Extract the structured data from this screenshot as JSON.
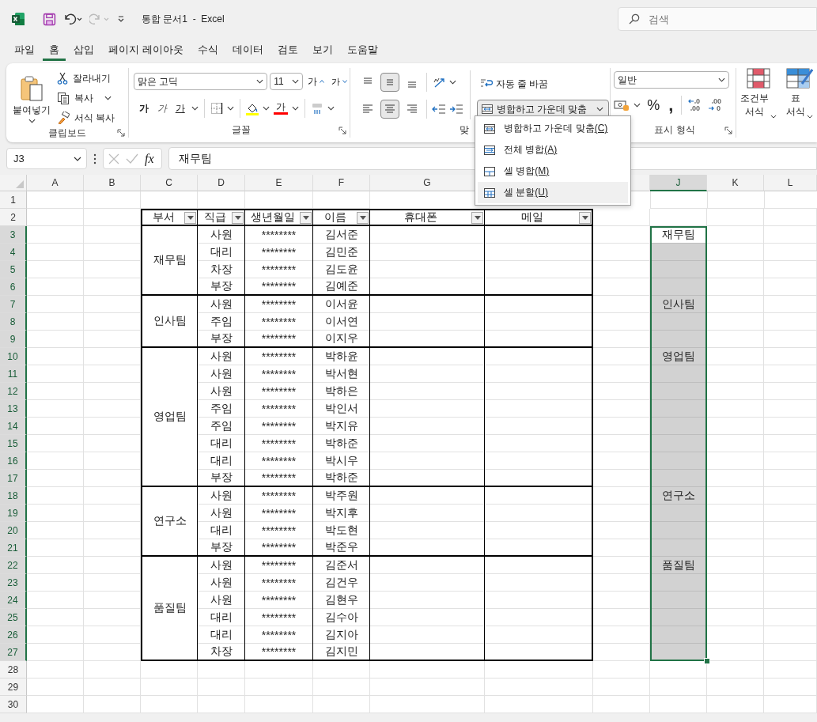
{
  "titlebar": {
    "quick_access": [
      {
        "kind": "save",
        "disabled": false
      },
      {
        "kind": "undo",
        "disabled": false
      },
      {
        "kind": "redo",
        "disabled": true
      },
      {
        "kind": "customize",
        "disabled": false
      }
    ],
    "title": "통합 문서1  -  Excel",
    "search": {
      "placeholder": "검색"
    }
  },
  "menu_tabs": [
    {
      "label": "파일",
      "selected": false
    },
    {
      "label": "홈",
      "selected": true
    },
    {
      "label": "삽입",
      "selected": false
    },
    {
      "label": "페이지 레이아웃",
      "selected": false
    },
    {
      "label": "수식",
      "selected": false
    },
    {
      "label": "데이터",
      "selected": false
    },
    {
      "label": "검토",
      "selected": false
    },
    {
      "label": "보기",
      "selected": false
    },
    {
      "label": "도움말",
      "selected": false
    }
  ],
  "ribbon": {
    "clipboard": {
      "label": "클립보드",
      "paste": "붙여넣기",
      "cut": "잘라내기",
      "copy": "복사",
      "format_painter": "서식 복사"
    },
    "font": {
      "label": "글꼴",
      "font_name": "맑은 고딕",
      "font_size": "11",
      "grow": "가",
      "shrink": "가",
      "bold": "가",
      "italic": "가",
      "underline": "가",
      "font_color": "가"
    },
    "alignment": {
      "label": "맞",
      "vertical_align": [
        {
          "kind": "top",
          "selected": false
        },
        {
          "kind": "middle",
          "selected": true
        },
        {
          "kind": "bottom",
          "selected": false
        }
      ],
      "horizontal_align": [
        {
          "kind": "left",
          "selected": false
        },
        {
          "kind": "center",
          "selected": true
        },
        {
          "kind": "right",
          "selected": false
        }
      ],
      "wrap_text": "자동 줄 바꿈",
      "merge": "병합하고 가운데 맞춤"
    },
    "number": {
      "label": "표시 형식",
      "format": "일반",
      "percent": "%",
      "comma": ","
    },
    "styles": {
      "conditional": "조건부 서식",
      "table": "표 서식"
    }
  },
  "merge_menu": {
    "open": true,
    "items": [
      {
        "label": "병합하고 가운데 맞춤",
        "shortcut": "(C)",
        "kind": "merge-center",
        "selected": false
      },
      {
        "label": "전체 병합",
        "shortcut": "(A)",
        "kind": "merge-across",
        "selected": false
      },
      {
        "label": "셀 병합",
        "shortcut": "(M)",
        "kind": "merge-cells",
        "selected": false
      },
      {
        "label": "셀 분할",
        "shortcut": "(U)",
        "kind": "unmerge",
        "selected": true
      }
    ]
  },
  "formula_bar": {
    "name_box": "J3",
    "fx": "fx",
    "value": "재무팀"
  },
  "sheet": {
    "columns": [
      {
        "header": "A",
        "selected": false
      },
      {
        "header": "B",
        "selected": false
      },
      {
        "header": "C",
        "selected": false
      },
      {
        "header": "D",
        "selected": false
      },
      {
        "header": "E",
        "selected": false
      },
      {
        "header": "F",
        "selected": false
      },
      {
        "header": "G",
        "selected": false
      },
      {
        "header": "J",
        "selected": true
      },
      {
        "header": "K",
        "selected": false
      },
      {
        "header": "L",
        "selected": false
      }
    ],
    "rows": [
      {
        "header": "1",
        "selected": false
      },
      {
        "header": "2",
        "selected": false
      },
      {
        "header": "3",
        "selected": true
      },
      {
        "header": "4",
        "selected": true
      },
      {
        "header": "5",
        "selected": true
      },
      {
        "header": "6",
        "selected": true
      },
      {
        "header": "7",
        "selected": true
      },
      {
        "header": "8",
        "selected": true
      },
      {
        "header": "9",
        "selected": true
      },
      {
        "header": "10",
        "selected": true
      },
      {
        "header": "11",
        "selected": true
      },
      {
        "header": "12",
        "selected": true
      },
      {
        "header": "13",
        "selected": true
      },
      {
        "header": "14",
        "selected": true
      },
      {
        "header": "15",
        "selected": true
      },
      {
        "header": "16",
        "selected": true
      },
      {
        "header": "17",
        "selected": true
      },
      {
        "header": "18",
        "selected": true
      },
      {
        "header": "19",
        "selected": true
      },
      {
        "header": "20",
        "selected": true
      },
      {
        "header": "21",
        "selected": true
      },
      {
        "header": "22",
        "selected": true
      },
      {
        "header": "23",
        "selected": true
      },
      {
        "header": "24",
        "selected": true
      },
      {
        "header": "25",
        "selected": true
      },
      {
        "header": "26",
        "selected": true
      },
      {
        "header": "27",
        "selected": true
      },
      {
        "header": "28",
        "selected": false
      },
      {
        "header": "29",
        "selected": false
      },
      {
        "header": "30",
        "selected": false
      }
    ],
    "table": {
      "headers": [
        "부서",
        "직급",
        "생년월일",
        "이름",
        "휴대폰",
        "메일"
      ],
      "groups": [
        {
          "department": "재무팀",
          "members": [
            {
              "rank": "사원",
              "birth": "********",
              "name": "김서준"
            },
            {
              "rank": "대리",
              "birth": "********",
              "name": "김민준"
            },
            {
              "rank": "차장",
              "birth": "********",
              "name": "김도윤"
            },
            {
              "rank": "부장",
              "birth": "********",
              "name": "김예준"
            }
          ]
        },
        {
          "department": "인사팀",
          "members": [
            {
              "rank": "사원",
              "birth": "********",
              "name": "이서윤"
            },
            {
              "rank": "주임",
              "birth": "********",
              "name": "이서연"
            },
            {
              "rank": "부장",
              "birth": "********",
              "name": "이지우"
            }
          ]
        },
        {
          "department": "영업팀",
          "members": [
            {
              "rank": "사원",
              "birth": "********",
              "name": "박하윤"
            },
            {
              "rank": "사원",
              "birth": "********",
              "name": "박서현"
            },
            {
              "rank": "사원",
              "birth": "********",
              "name": "박하은"
            },
            {
              "rank": "주임",
              "birth": "********",
              "name": "박인서"
            },
            {
              "rank": "주임",
              "birth": "********",
              "name": "박지유"
            },
            {
              "rank": "대리",
              "birth": "********",
              "name": "박하준"
            },
            {
              "rank": "대리",
              "birth": "********",
              "name": "박시우"
            },
            {
              "rank": "부장",
              "birth": "********",
              "name": "박하준"
            }
          ]
        },
        {
          "department": "연구소",
          "members": [
            {
              "rank": "사원",
              "birth": "********",
              "name": "박주원"
            },
            {
              "rank": "사원",
              "birth": "********",
              "name": "박지후"
            },
            {
              "rank": "대리",
              "birth": "********",
              "name": "박도현"
            },
            {
              "rank": "부장",
              "birth": "********",
              "name": "박준우"
            }
          ]
        },
        {
          "department": "품질팀",
          "members": [
            {
              "rank": "사원",
              "birth": "********",
              "name": "김준서"
            },
            {
              "rank": "사원",
              "birth": "********",
              "name": "김건우"
            },
            {
              "rank": "사원",
              "birth": "********",
              "name": "김현우"
            },
            {
              "rank": "대리",
              "birth": "********",
              "name": "김수아"
            },
            {
              "rank": "대리",
              "birth": "********",
              "name": "김지아"
            },
            {
              "rank": "차장",
              "birth": "********",
              "name": "김지민"
            }
          ]
        }
      ]
    },
    "side_cells": [
      {
        "text": "재무팀",
        "active": true
      },
      {
        "text": "인사팀",
        "active": false
      },
      {
        "text": "영업팀",
        "active": false
      },
      {
        "text": "연구소",
        "active": false
      },
      {
        "text": "품질팀",
        "active": false
      }
    ]
  }
}
